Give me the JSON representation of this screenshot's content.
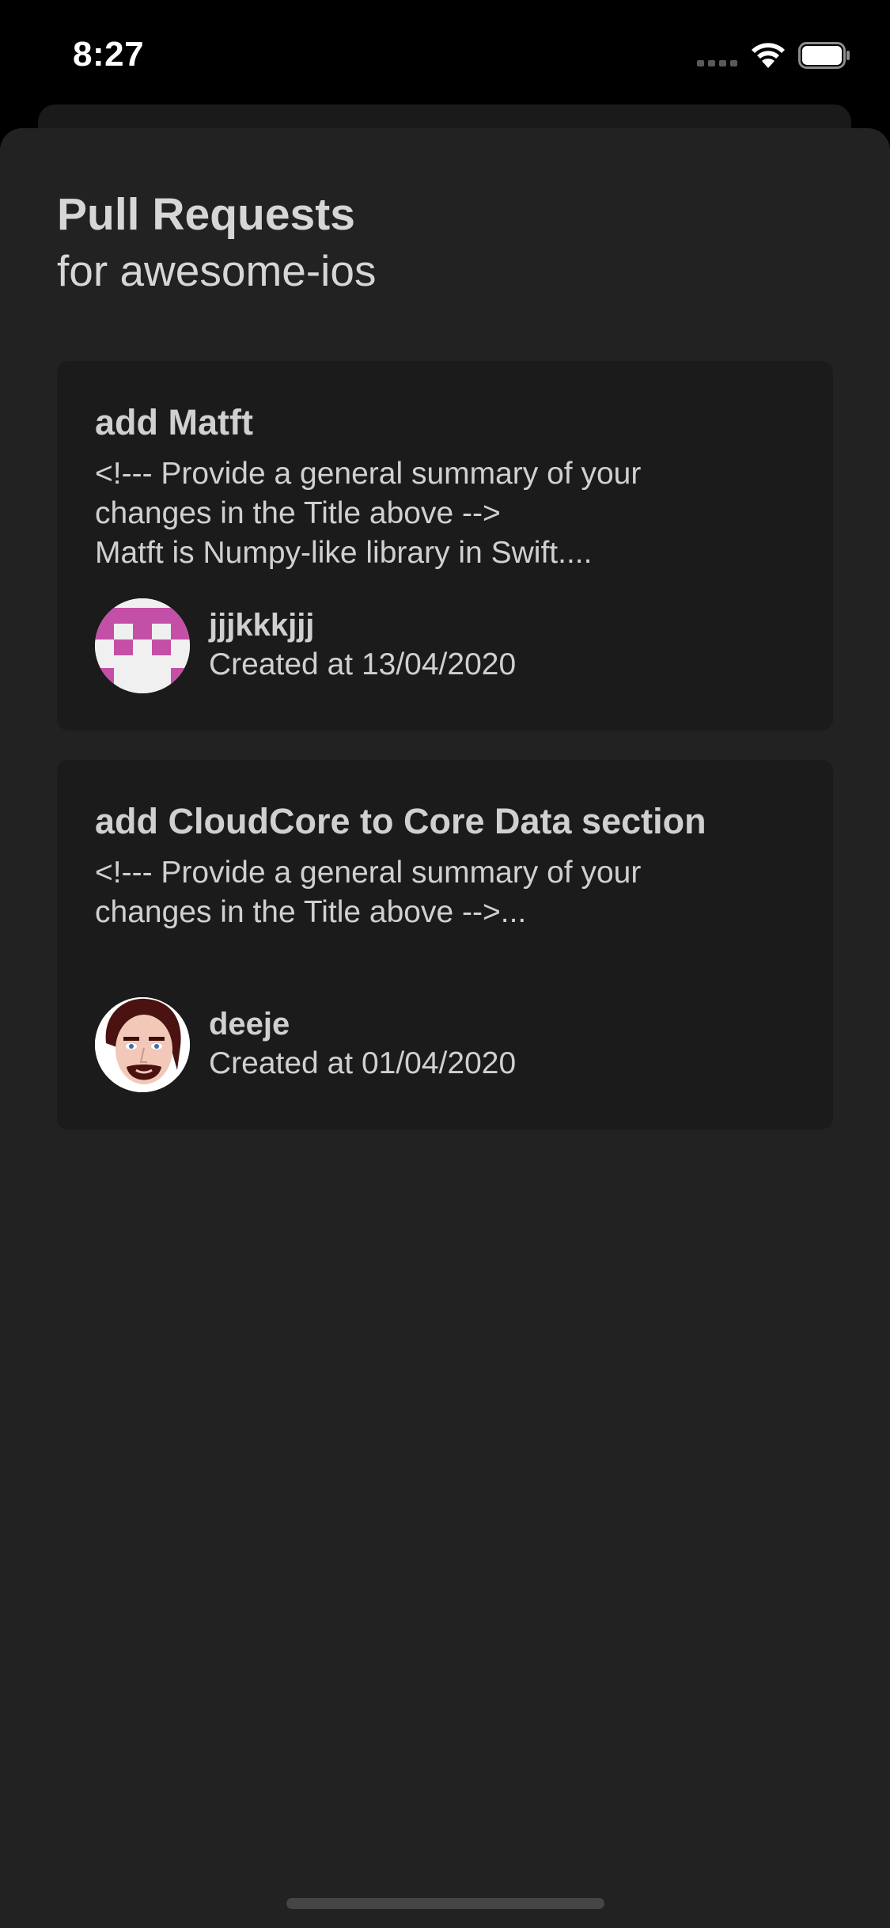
{
  "status_bar": {
    "time": "8:27"
  },
  "header": {
    "title": "Pull Requests",
    "subtitle": "for awesome-ios"
  },
  "pull_requests": [
    {
      "title": "add Matft",
      "body": "<!--- Provide a general summary of your\nchanges in the Title above -->\nMatft is Numpy-like library in Swift....",
      "author": "jjjkkkjjj",
      "created": "Created at 13/04/2020",
      "avatar_icon": "pink-identicon"
    },
    {
      "title": "add CloudCore to Core Data section",
      "body": "<!--- Provide a general summary of your\nchanges in the Title above -->...",
      "author": "deeje",
      "created": "Created at 01/04/2020",
      "avatar_icon": "cartoon-face-avatar"
    }
  ],
  "colors": {
    "background": "#000000",
    "sheet": "#222222",
    "card": "#1b1b1b",
    "text": "#d0d0d0",
    "identicon": "#c44fa6"
  }
}
